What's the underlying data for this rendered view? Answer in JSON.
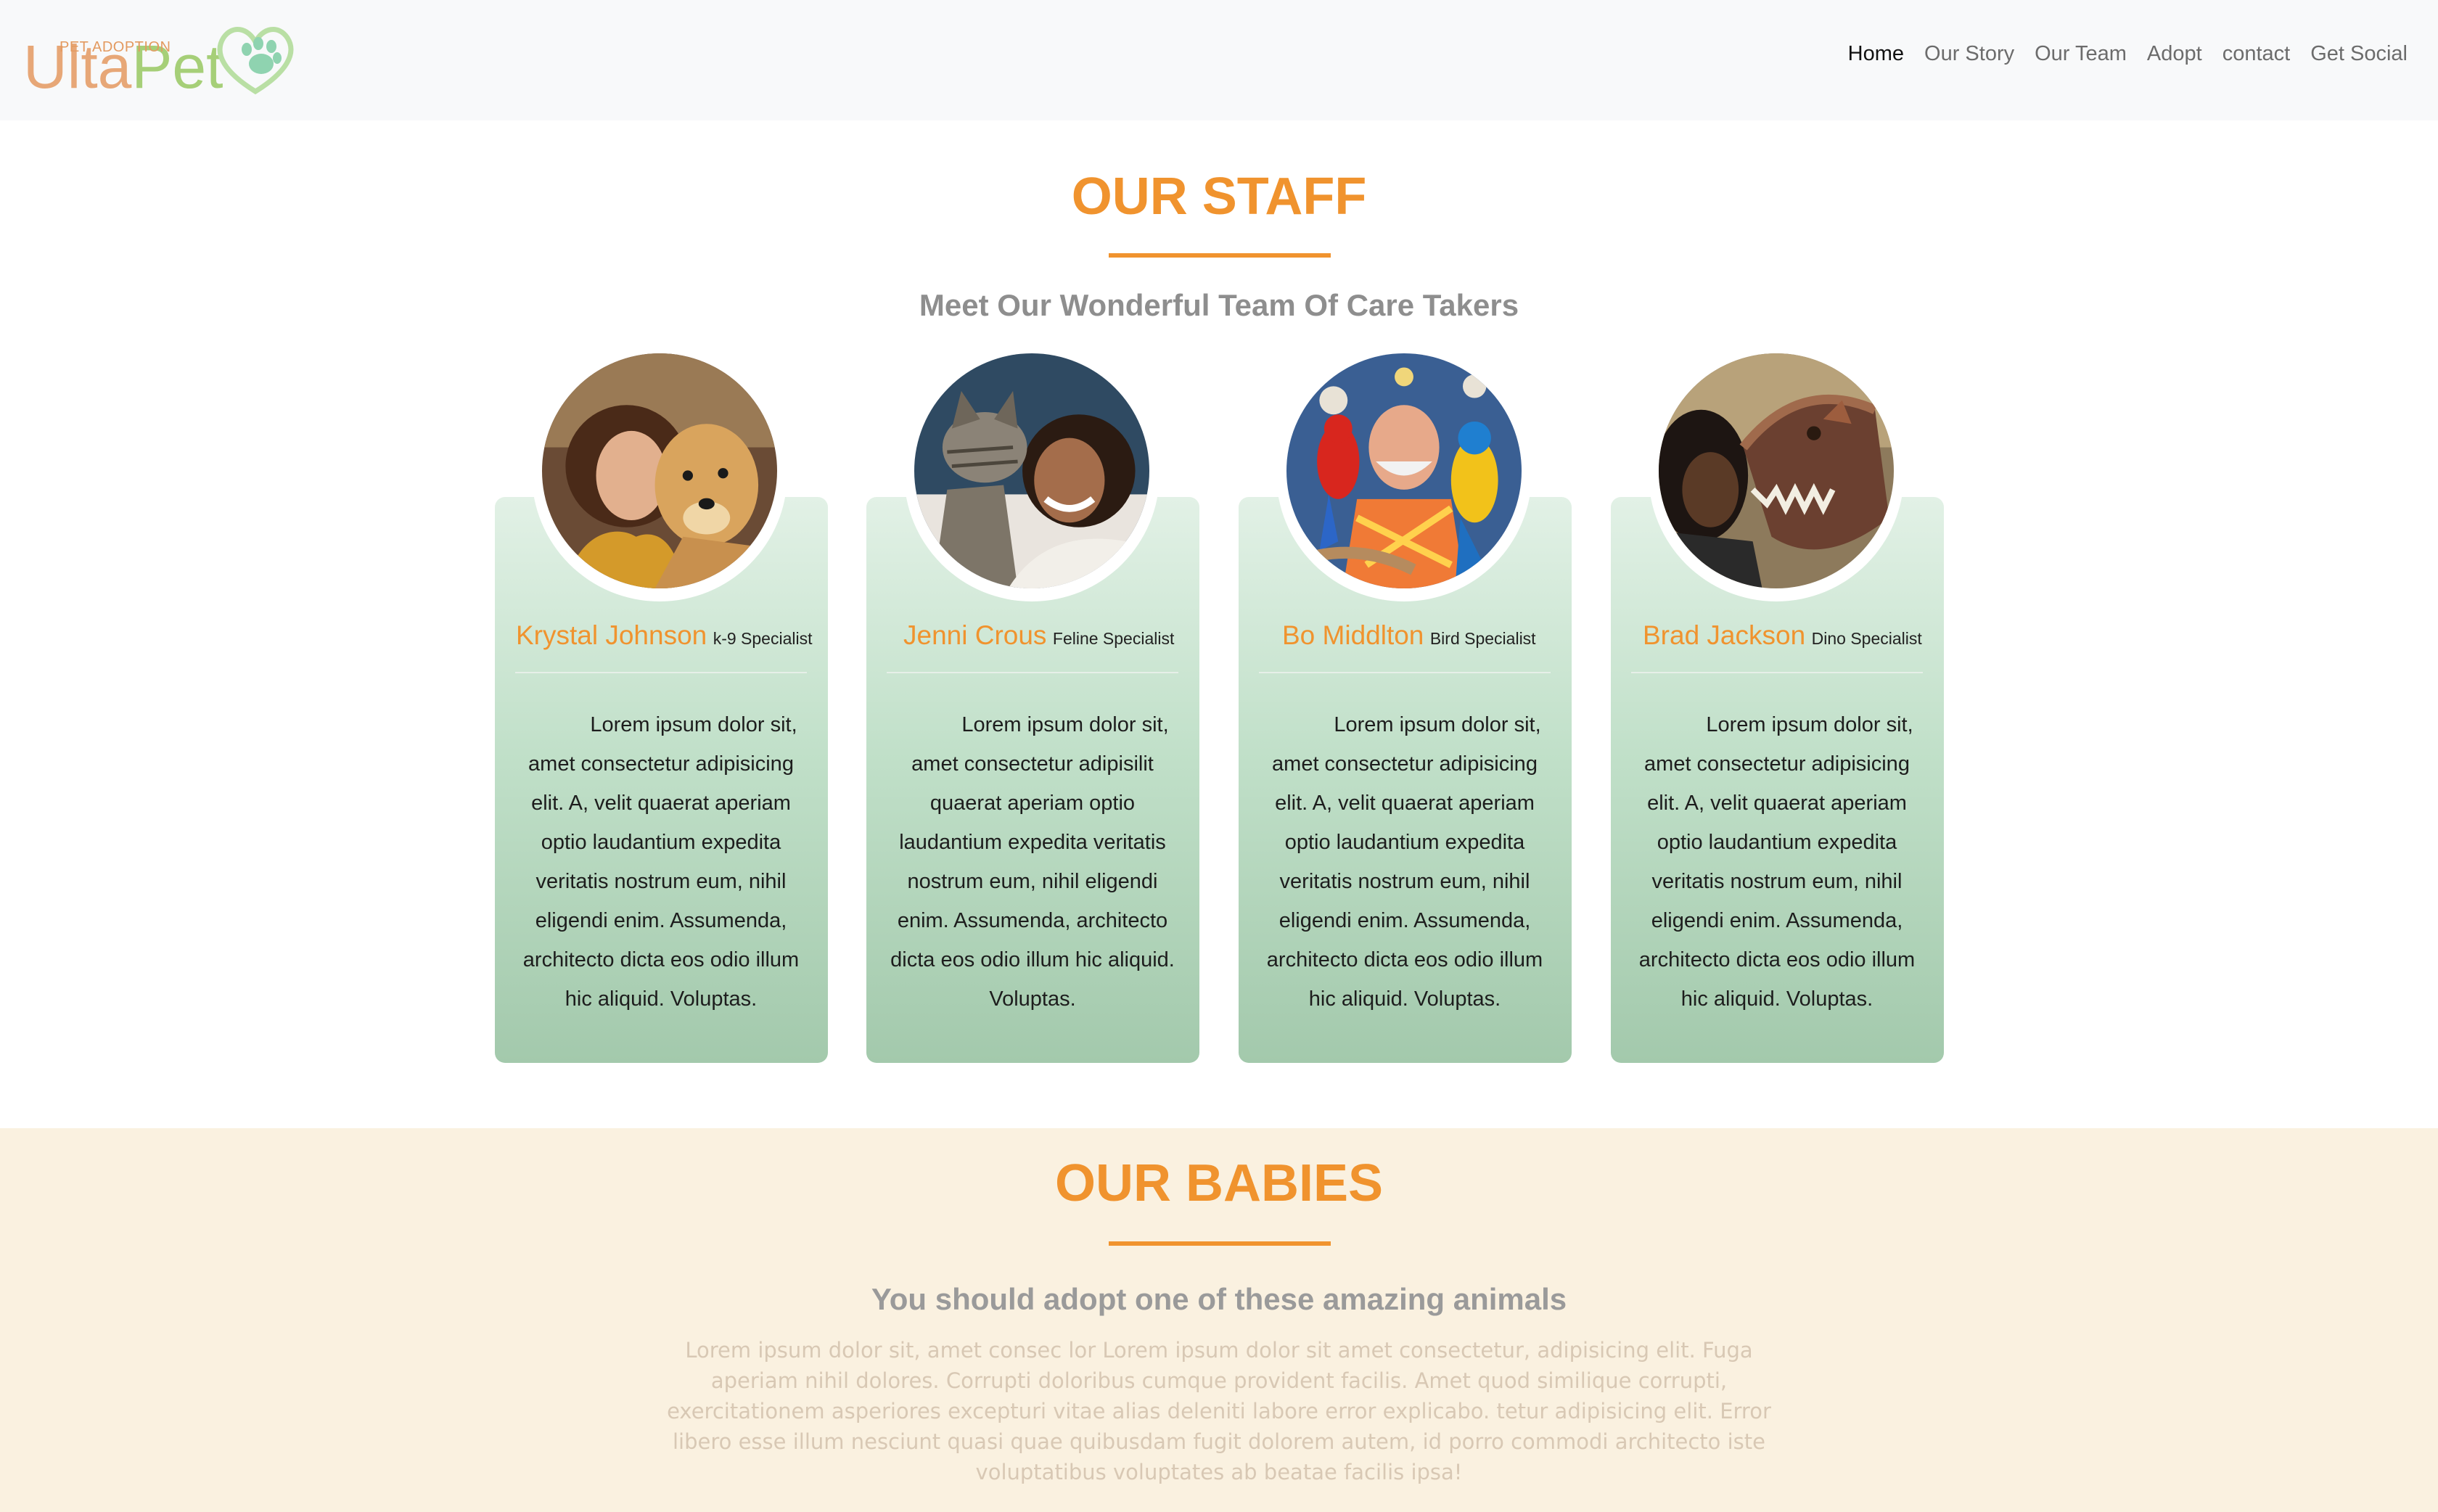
{
  "nav": {
    "logo": {
      "word_a": "Ulta",
      "word_b": "Pet",
      "tagline": "PET ADOPTION"
    },
    "links": [
      "Home",
      "Our Story",
      "Our Team",
      "Adopt",
      "contact",
      "Get Social"
    ],
    "active": "Home"
  },
  "staff": {
    "title": "OUR STAFF",
    "subtitle": "Meet Our Wonderful Team Of Care Takers",
    "members": [
      {
        "name": "Krystal Johnson",
        "role": "k-9 Specialist",
        "photo": "woman-with-golden-retriever",
        "bio": "Lorem ipsum dolor sit, amet consectetur adipisicing elit. A, velit quaerat aperiam optio laudantium expedita veritatis nostrum eum, nihil eligendi enim. Assumenda, architecto dicta eos odio illum hic aliquid. Voluptas."
      },
      {
        "name": "Jenni Crous",
        "role": "Feline Specialist",
        "photo": "woman-with-tabby-cat",
        "bio": "Lorem ipsum dolor sit, amet consectetur adipisilit quaerat aperiam optio laudantium expedita veritatis nostrum eum, nihil eligendi enim. Assumenda, architecto dicta eos odio illum hic aliquid. Voluptas."
      },
      {
        "name": "Bo Middlton",
        "role": "Bird Specialist",
        "photo": "man-with-macaws",
        "bio": "Lorem ipsum dolor sit, amet consectetur adipisicing elit. A, velit quaerat aperiam optio laudantium expedita veritatis nostrum eum, nihil eligendi enim. Assumenda, architecto dicta eos odio illum hic aliquid. Voluptas."
      },
      {
        "name": "Brad Jackson",
        "role": "Dino Specialist",
        "photo": "person-with-dinosaur",
        "bio": "Lorem ipsum dolor sit, amet consectetur adipisicing elit. A, velit quaerat aperiam optio laudantium expedita veritatis nostrum eum, nihil eligendi enim. Assumenda, architecto dicta eos odio illum hic aliquid. Voluptas."
      }
    ]
  },
  "babies": {
    "title": "OUR BABIES",
    "subtitle": "You should adopt one of these amazing animals",
    "paragraph": "Lorem ipsum dolor sit, amet consec lor Lorem ipsum dolor sit amet consectetur, adipisicing elit. Fuga aperiam nihil dolores. Corrupti doloribus cumque provident facilis. Amet quod similique corrupti, exercitationem asperiores excepturi vitae alias deleniti labore error explicabo. tetur adipisicing elit. Error libero esse illum nesciunt quasi quae quibusdam fugit dolorem autem, id porro commodi architecto iste voluptatibus voluptates ab beatae facilis ipsa!"
  },
  "colors": {
    "accent": "#f0932e",
    "card_top": "#e2f1e6",
    "card_bottom": "#a3c9ac",
    "babies_bg": "#faf1e0",
    "navbar_bg": "#f8f9fa"
  }
}
